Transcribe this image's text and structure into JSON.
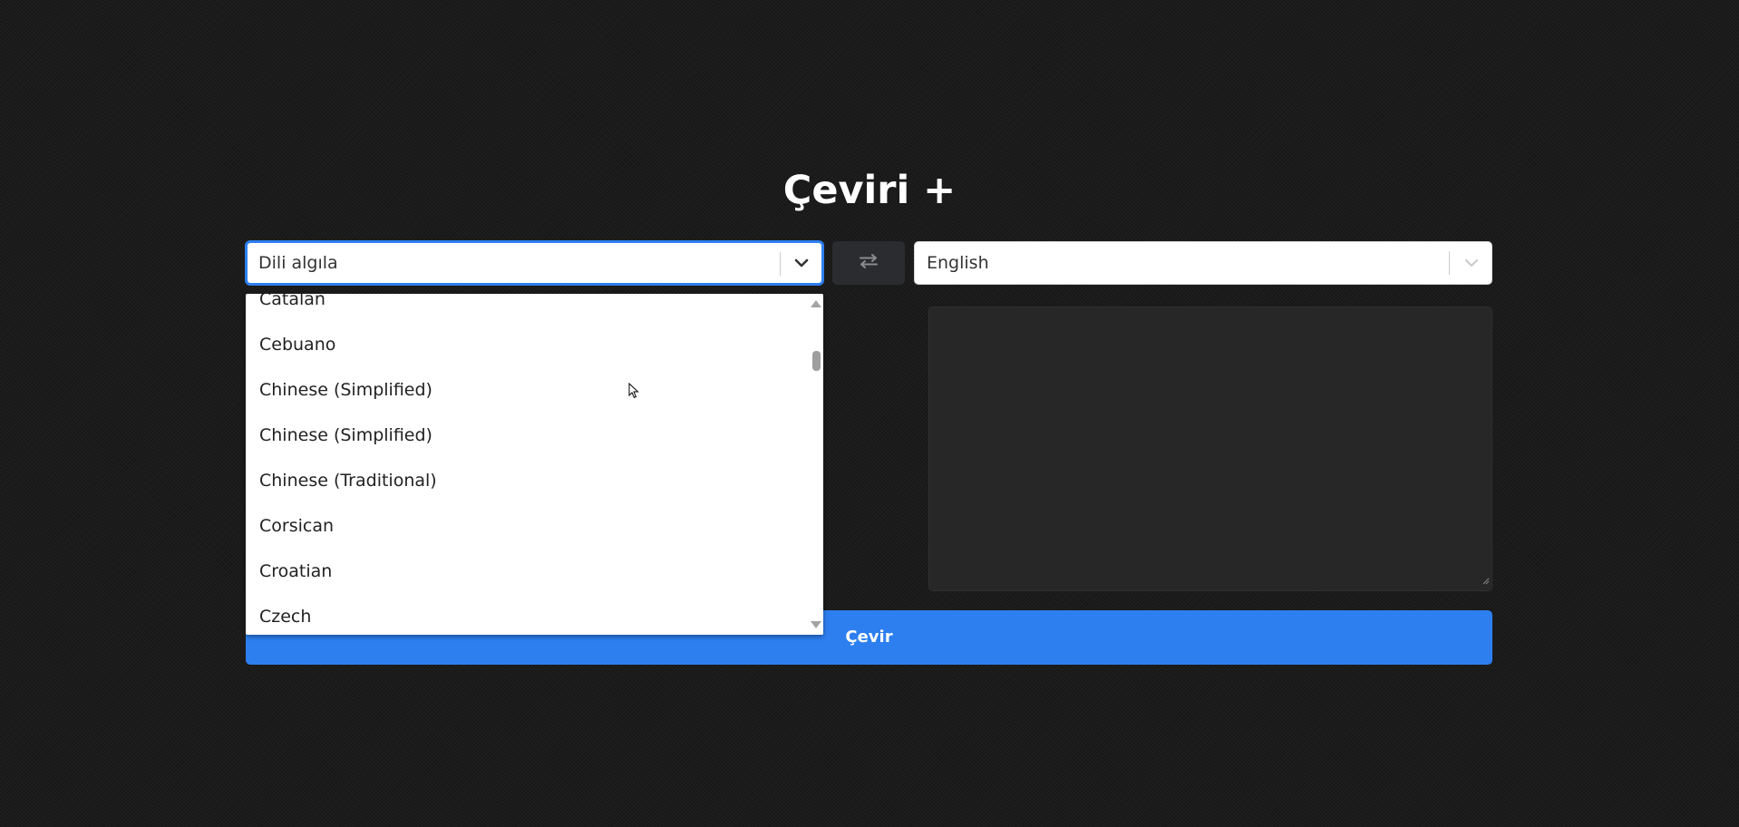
{
  "app": {
    "title": "Çeviri +"
  },
  "source_select": {
    "value": "Dili algıla",
    "icon": "chevron-down-icon"
  },
  "swap_button": {
    "icon": "swap-arrows-icon"
  },
  "target_select": {
    "value": "English",
    "icon": "chevron-down-icon"
  },
  "dropdown": {
    "options": [
      "Catalan",
      "Cebuano",
      "Chinese (Simplified)",
      "Chinese (Simplified)",
      "Chinese (Traditional)",
      "Corsican",
      "Croatian",
      "Czech"
    ]
  },
  "output_area": {
    "value": ""
  },
  "translate_button": {
    "label": "Çevir"
  },
  "colors": {
    "accent": "#2d7ff0",
    "background": "#1c1c1c",
    "swap_button_bg": "#2b2c30",
    "output_bg": "#272727"
  }
}
